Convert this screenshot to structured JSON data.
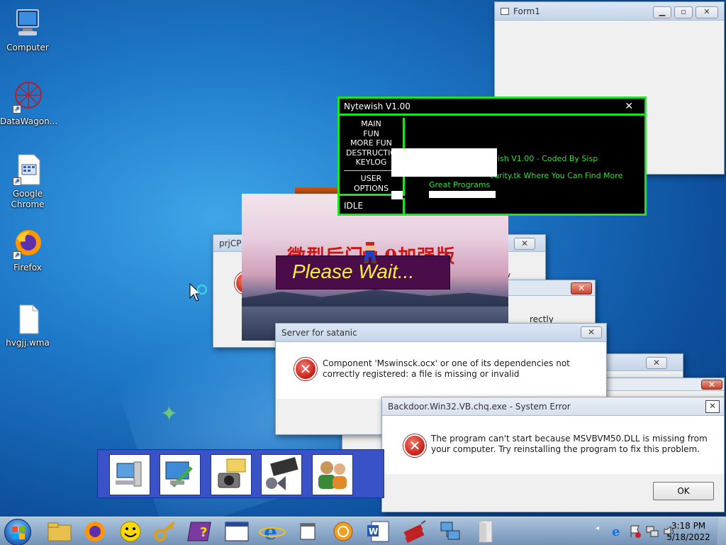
{
  "desktop": {
    "icons": [
      {
        "label": "Computer"
      },
      {
        "label": "DataWagon..."
      },
      {
        "label": "Google Chrome"
      },
      {
        "label": "Firefox"
      },
      {
        "label": "hvgjj.wma"
      }
    ]
  },
  "form1": {
    "title": "Form1"
  },
  "nytewish": {
    "title": "Nytewish V1.00",
    "menu": [
      "MAIN",
      "FUN",
      "MORE FUN",
      "DESTRUCTIO",
      "KEYLOG",
      "USER",
      "OPTIONS"
    ],
    "status": "IDLE",
    "line1": "wish V1.00 - Coded By Sisp",
    "line2": "curity.tk Where You Can Find More",
    "line3": "Great Programs"
  },
  "wait": {
    "cn_title": "微型后门1.0加强版",
    "banner": "Please Wait..."
  },
  "bg_windows": {
    "prj_title": "prjCP",
    "partial_text_a": "y",
    "partial_text_b": "rectly"
  },
  "satanic": {
    "title": "Server for satanic",
    "message": "Component 'Mswinsck.ocx' or one of its dependencies not correctly registered: a file is missing or invalid"
  },
  "backdoor": {
    "title": "Backdoor.Win32.VB.chq.exe - System Error",
    "message": "The program can't start because MSVBVM50.DLL is missing from your computer. Try reinstalling the program to fix this problem.",
    "ok": "OK"
  },
  "taskbar": {
    "time": "3:18 PM",
    "date": "5/18/2022"
  },
  "colors": {
    "nyte_green": "#1ee41e",
    "error_red": "#c81e14",
    "banner_yellow": "#f5f233"
  }
}
